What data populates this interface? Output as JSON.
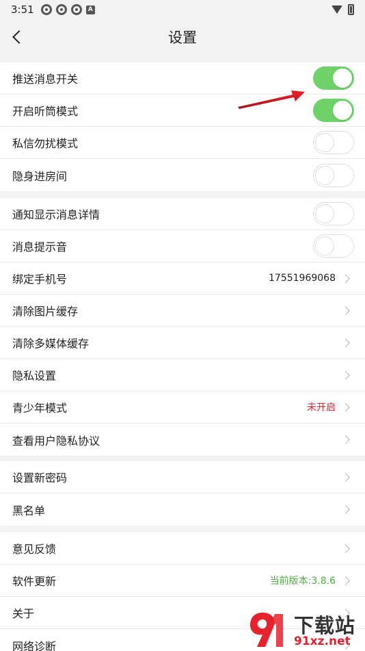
{
  "status_bar": {
    "time": "3:51",
    "left_icons": [
      "notification-icon",
      "notification-icon",
      "notification-icon",
      "a-icon"
    ],
    "a_label": "A",
    "right_icons": [
      "wifi-icon",
      "battery-icon"
    ]
  },
  "header": {
    "title": "设置",
    "back_icon": "chevron-left-icon"
  },
  "groups": [
    {
      "items": [
        {
          "label": "推送消息开关",
          "type": "toggle",
          "on": true
        },
        {
          "label": "开启听筒模式",
          "type": "toggle",
          "on": true
        },
        {
          "label": "私信勿扰模式",
          "type": "toggle",
          "on": false
        },
        {
          "label": "隐身进房间",
          "type": "toggle",
          "on": false
        }
      ]
    },
    {
      "items": [
        {
          "label": "通知显示消息详情",
          "type": "toggle",
          "on": false
        },
        {
          "label": "消息提示音",
          "type": "toggle",
          "on": false
        },
        {
          "label": "绑定手机号",
          "type": "nav",
          "value": "17551969068"
        },
        {
          "label": "清除图片缓存",
          "type": "nav"
        },
        {
          "label": "清除多媒体缓存",
          "type": "nav"
        },
        {
          "label": "隐私设置",
          "type": "nav"
        },
        {
          "label": "青少年模式",
          "type": "nav",
          "value": "未开启"
        },
        {
          "label": "查看用户隐私协议",
          "type": "nav"
        }
      ]
    },
    {
      "items": [
        {
          "label": "设置新密码",
          "type": "nav"
        },
        {
          "label": "黑名单",
          "type": "nav"
        }
      ]
    },
    {
      "items": [
        {
          "label": "意见反馈",
          "type": "nav"
        },
        {
          "label": "软件更新",
          "type": "nav",
          "value": "当前版本:3.8.6"
        },
        {
          "label": "关于",
          "type": "nav"
        },
        {
          "label": "网络诊断",
          "type": "nav"
        }
      ]
    }
  ],
  "colors": {
    "toggle_on": "#6fd16a",
    "teen_mode_value": "#e5232e",
    "version_value": "#4cb03f",
    "annotation_arrow": "#d9201f"
  },
  "watermark": {
    "title": "下载站",
    "url": "91xz.net"
  }
}
